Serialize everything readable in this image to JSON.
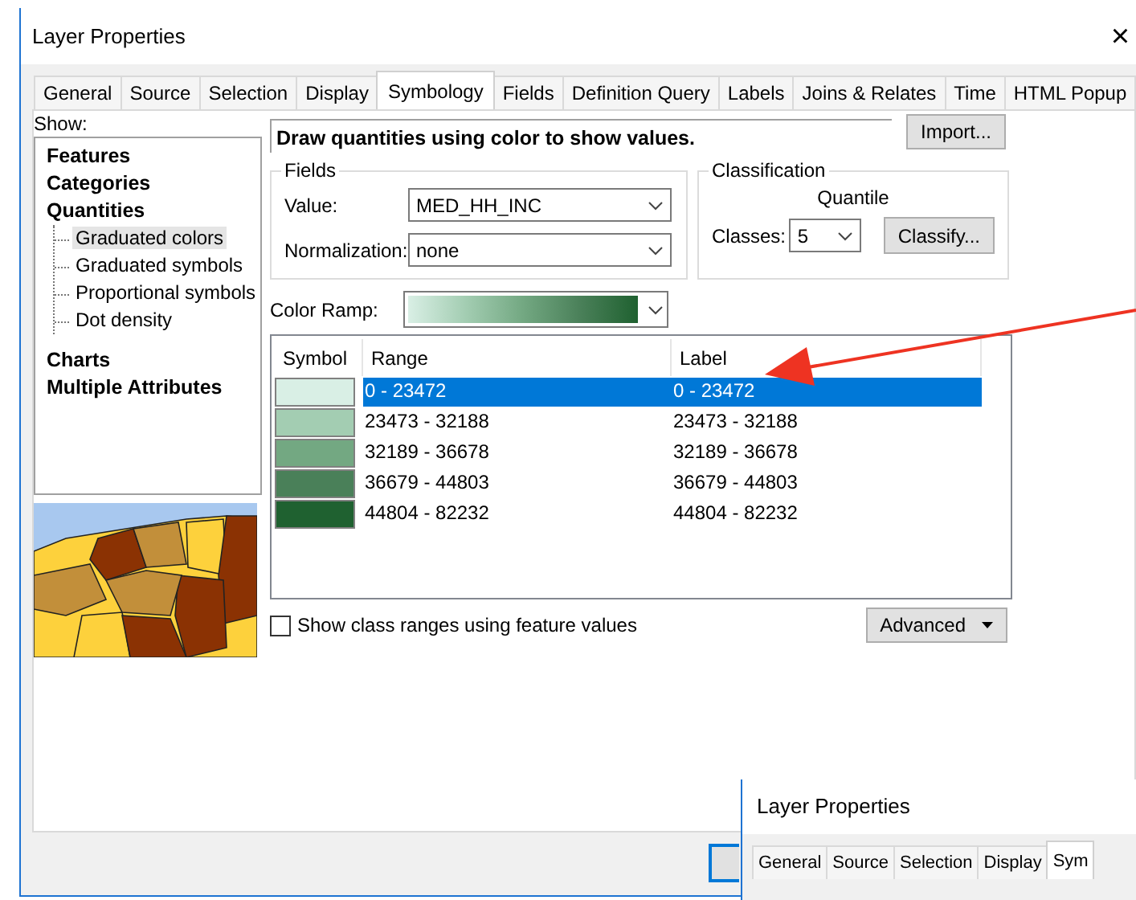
{
  "window": {
    "title": "Layer Properties",
    "close": "×"
  },
  "tabs": [
    {
      "label": "General",
      "selected": false
    },
    {
      "label": "Source",
      "selected": false
    },
    {
      "label": "Selection",
      "selected": false
    },
    {
      "label": "Display",
      "selected": false
    },
    {
      "label": "Symbology",
      "selected": true
    },
    {
      "label": "Fields",
      "selected": false
    },
    {
      "label": "Definition Query",
      "selected": false
    },
    {
      "label": "Labels",
      "selected": false
    },
    {
      "label": "Joins & Relates",
      "selected": false
    },
    {
      "label": "Time",
      "selected": false
    },
    {
      "label": "HTML Popup",
      "selected": false
    }
  ],
  "show": {
    "label": "Show:",
    "tree": [
      {
        "label": "Features",
        "selected": false
      },
      {
        "label": "Categories",
        "selected": false
      },
      {
        "label": "Quantities",
        "selected": false,
        "children": [
          {
            "label": "Graduated colors",
            "selected": true
          },
          {
            "label": "Graduated symbols",
            "selected": false
          },
          {
            "label": "Proportional symbols",
            "selected": false
          },
          {
            "label": "Dot density",
            "selected": false
          }
        ]
      },
      {
        "label": "Charts",
        "selected": false
      },
      {
        "label": "Multiple Attributes",
        "selected": false
      }
    ]
  },
  "description": "Draw quantities using color to show values.",
  "import_button": "Import...",
  "fields": {
    "title": "Fields",
    "value": {
      "label": "Value:",
      "value": "MED_HH_INC"
    },
    "normalization": {
      "label": "Normalization:",
      "value": "none"
    }
  },
  "classification": {
    "title": "Classification",
    "method": "Quantile",
    "classes": {
      "label": "Classes:",
      "value": "5"
    },
    "classify_button": "Classify..."
  },
  "color_ramp": {
    "label": "Color Ramp:"
  },
  "table": {
    "columns": [
      "Symbol",
      "Range",
      "Label"
    ],
    "rows": [
      {
        "color": "#d9efe5",
        "range": "0 - 23472",
        "label": "0 - 23472",
        "selected": true
      },
      {
        "color": "#a3cdb2",
        "range": "23473 - 32188",
        "label": "23473 - 32188",
        "selected": false
      },
      {
        "color": "#73a882",
        "range": "32189 - 36678",
        "label": "32189 - 36678",
        "selected": false
      },
      {
        "color": "#4a8059",
        "range": "36679 - 44803",
        "label": "36679 - 44803",
        "selected": false
      },
      {
        "color": "#1f6130",
        "range": "44804 - 82232",
        "label": "44804 - 82232",
        "selected": false
      }
    ]
  },
  "show_class_ranges": {
    "label": "Show class ranges using feature values",
    "checked": false
  },
  "advanced_button": "Advanced",
  "second_window": {
    "title": "Layer Properties",
    "tabs": [
      {
        "label": "General",
        "selected": false
      },
      {
        "label": "Source",
        "selected": false
      },
      {
        "label": "Selection",
        "selected": false
      },
      {
        "label": "Display",
        "selected": false
      },
      {
        "label": "Sym",
        "selected": true
      }
    ]
  }
}
